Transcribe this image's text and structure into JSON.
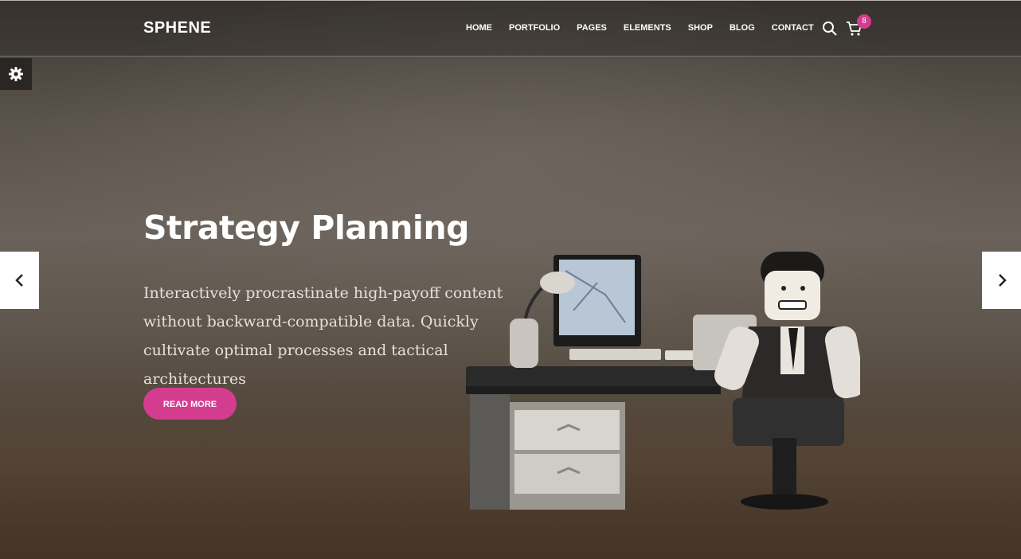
{
  "header": {
    "logo": "SPHENE",
    "nav": [
      "HOME",
      "PORTFOLIO",
      "PAGES",
      "ELEMENTS",
      "SHOP",
      "BLOG",
      "CONTACT"
    ],
    "cart_count": "8",
    "icons": [
      "search-icon",
      "cart-icon"
    ]
  },
  "sidebar": {
    "icon": "gear-icon"
  },
  "hero": {
    "title": "Strategy Planning",
    "text": "Interactively procrastinate high-payoff content without backward-compatible data. Quickly cultivate optimal processes and tactical architectures",
    "button_label": "READ MORE"
  },
  "slider": {
    "prev_icon": "chevron-left-icon",
    "next_icon": "chevron-right-icon"
  },
  "colors": {
    "accent": "#d43d8f",
    "text": "#ffffff",
    "body_text": "#e6e1dc"
  }
}
